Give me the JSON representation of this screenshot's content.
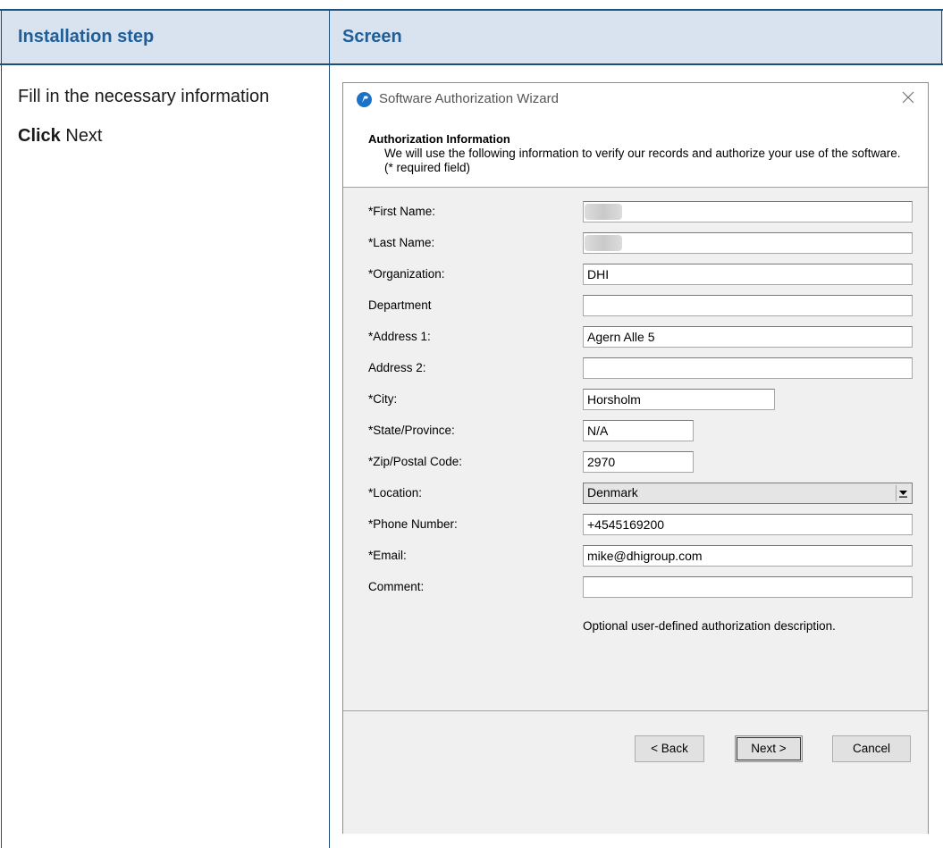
{
  "table": {
    "header_step": "Installation step",
    "header_screen": "Screen",
    "step_line1": "Fill in the necessary information",
    "step_click_bold": "Click",
    "step_click_rest": " Next"
  },
  "dialog": {
    "title": "Software Authorization Wizard",
    "section_title": "Authorization Information",
    "section_desc": "We will use the following information to verify our records and authorize your use of the software. (* required field)",
    "fields": {
      "first_name": {
        "label": "*First Name:",
        "value": ""
      },
      "last_name": {
        "label": "*Last Name:",
        "value": ""
      },
      "organization": {
        "label": "*Organization:",
        "value": "DHI"
      },
      "department": {
        "label": "Department",
        "value": ""
      },
      "address1": {
        "label": "*Address 1:",
        "value": "Agern Alle 5"
      },
      "address2": {
        "label": "Address 2:",
        "value": ""
      },
      "city": {
        "label": "*City:",
        "value": "Horsholm"
      },
      "state": {
        "label": "*State/Province:",
        "value": "N/A"
      },
      "zip": {
        "label": "*Zip/Postal Code:",
        "value": "2970"
      },
      "location": {
        "label": "*Location:",
        "value": "Denmark"
      },
      "phone": {
        "label": "*Phone Number:",
        "value": "+4545169200"
      },
      "email": {
        "label": "*Email:",
        "value": "mike@dhigroup.com"
      },
      "comment": {
        "label": "Comment:",
        "value": ""
      }
    },
    "comment_hint": "Optional user-defined authorization description.",
    "buttons": {
      "back": "< Back",
      "next": "Next >",
      "cancel": "Cancel"
    }
  },
  "colors": {
    "header_bg": "#d8e3ef",
    "header_text": "#1f5f99",
    "rule": "#1f4e79",
    "dialog_bg": "#f0f0f0"
  },
  "icons": {
    "app": "wizard-app-icon",
    "close": "close-icon",
    "dropdown": "chevron-down-icon"
  }
}
